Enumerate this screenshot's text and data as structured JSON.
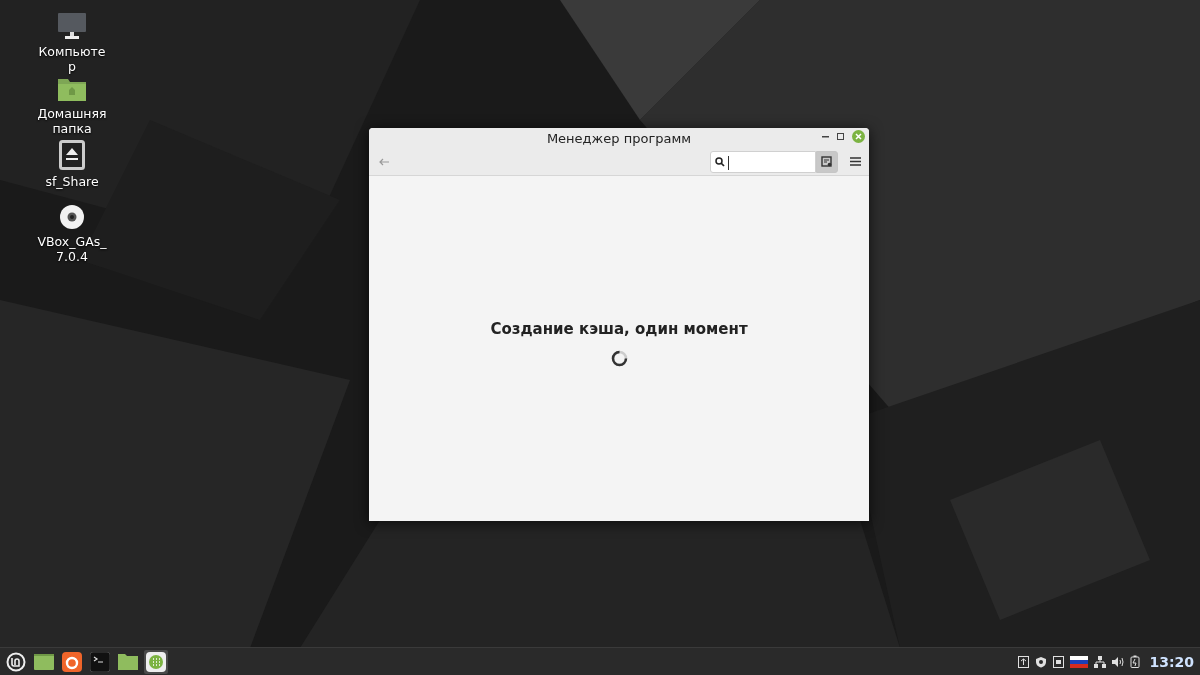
{
  "desktop_icons": [
    {
      "kind": "monitor",
      "label": "Компьютер"
    },
    {
      "kind": "folder",
      "label": "Домашняя папка"
    },
    {
      "kind": "drive",
      "label": "sf_Share"
    },
    {
      "kind": "disc",
      "label": "VBox_GAs_7.0.4"
    }
  ],
  "window": {
    "title": "Менеджер программ",
    "search_toggle": {
      "pressed": true
    },
    "message": "Создание кэша, один момент"
  },
  "taskbar": {
    "launchers": [
      {
        "kind": "menu",
        "selected": false
      },
      {
        "kind": "desktop",
        "selected": false
      },
      {
        "kind": "browser",
        "selected": false
      },
      {
        "kind": "terminal",
        "selected": false
      },
      {
        "kind": "files",
        "selected": false
      },
      {
        "kind": "software",
        "selected": true
      }
    ],
    "tray": [
      {
        "kind": "updates"
      },
      {
        "kind": "shield"
      },
      {
        "kind": "notes"
      },
      {
        "kind": "flag"
      },
      {
        "kind": "network"
      },
      {
        "kind": "volume"
      },
      {
        "kind": "power"
      }
    ],
    "clock": "13:20"
  }
}
